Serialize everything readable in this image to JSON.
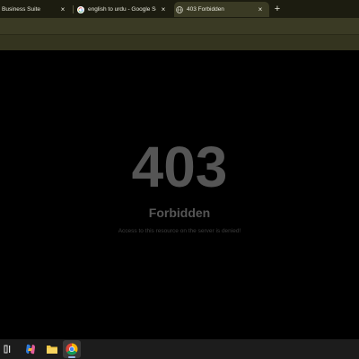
{
  "browser": {
    "tabs": [
      {
        "title": "Business Suite",
        "favicon": "none",
        "active": false
      },
      {
        "title": "english to urdu - Google Search",
        "favicon": "google-g-icon",
        "active": false
      },
      {
        "title": "403 Forbidden",
        "favicon": "globe-icon",
        "active": true
      }
    ],
    "new_tab_symbol": "+",
    "close_symbol": "×"
  },
  "page": {
    "error_code": "403",
    "error_title": "Forbidden",
    "error_message": "Access to this resource on the server is denied!"
  },
  "taskbar": {
    "items": [
      {
        "name": "task-view-icon",
        "active": false
      },
      {
        "name": "copilot-icon",
        "active": false
      },
      {
        "name": "file-explorer-icon",
        "active": false
      },
      {
        "name": "chrome-icon",
        "active": true
      }
    ]
  },
  "colors": {
    "tab_strip": "#1c1c10",
    "toolbar": "#3a3a24",
    "page_background": "#000000",
    "error_text": "#555555",
    "taskbar": "#1c1c1c"
  }
}
